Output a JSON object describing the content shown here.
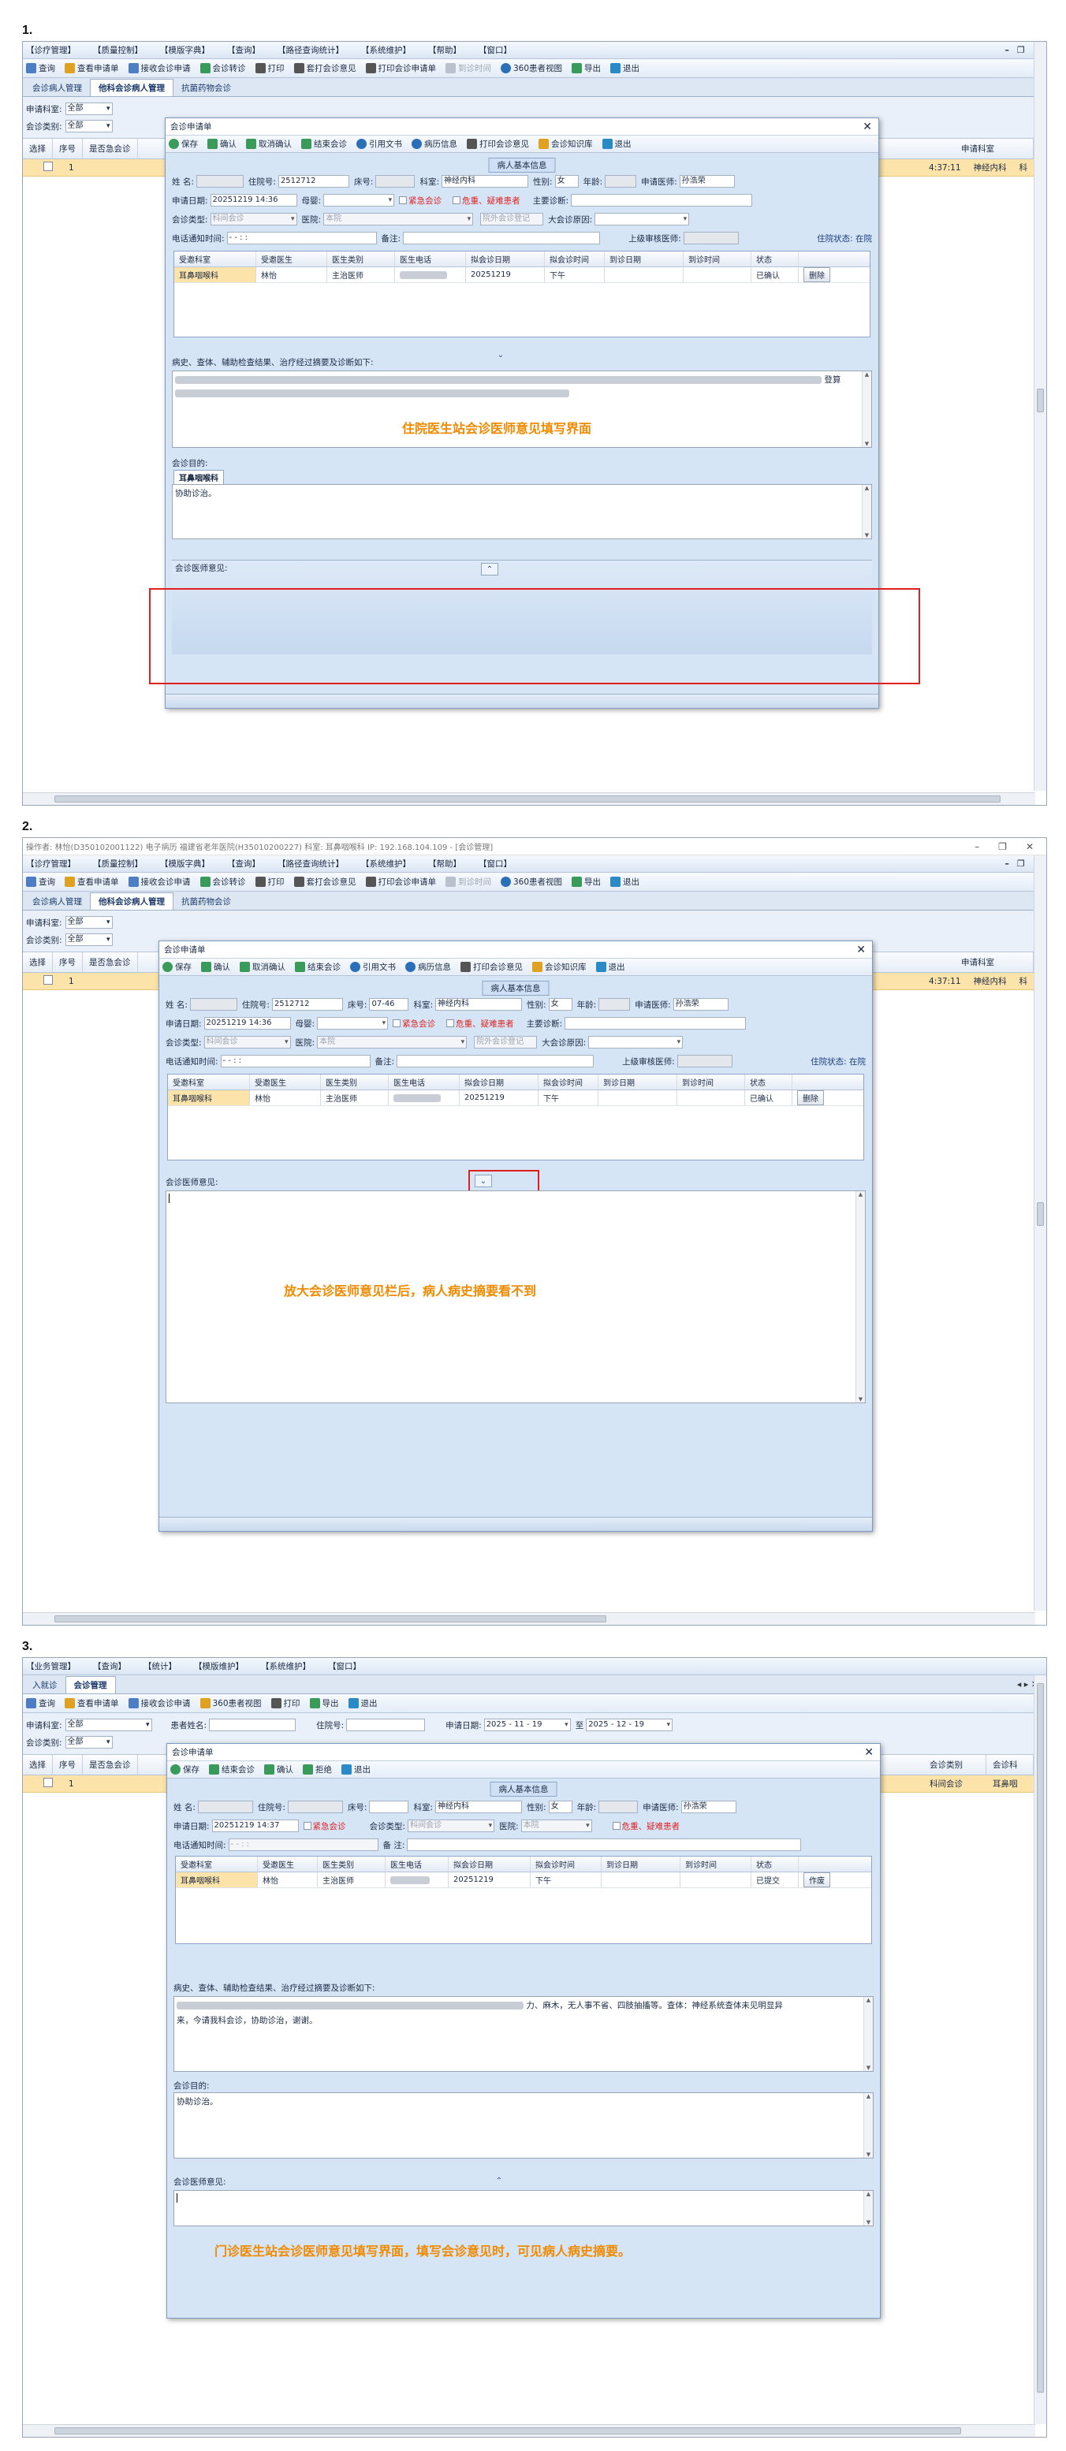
{
  "s1": {
    "num": "1.",
    "menu": [
      "【诊疗管理】",
      "【质量控制】",
      "【模版字典】",
      "【查询】",
      "【路径查询统计】",
      "【系统维护】",
      "【帮助】",
      "【窗口】"
    ],
    "tools": [
      "查询",
      "查看申请单",
      "接收会诊申请",
      "会诊转诊",
      "打印",
      "套打会诊意见",
      "打印会诊申请单",
      "到诊时间",
      "360患者视图",
      "导出",
      "退出"
    ],
    "tabs": [
      "会诊病人管理",
      "他科会诊病人管理",
      "抗菌药物会诊"
    ],
    "filter1_label": "申请科室:",
    "filter1_val": "全部",
    "filter2_label": "会诊类别:",
    "filter2_val": "全部",
    "grid_cols": [
      "选择",
      "序号",
      "是否急会诊"
    ],
    "grid_right_cols": [
      "申请科室"
    ],
    "row_num": "1",
    "row_time": "4:37:11",
    "row_dept": "神经内科",
    "row_extra": "科",
    "dlg_title": "会诊申请单",
    "dlg_tools": [
      "保存",
      "确认",
      "取消确认",
      "结束会诊",
      "引用文书",
      "病历信息",
      "打印会诊意见",
      "会诊知识库",
      "退出"
    ],
    "group_title": "病人基本信息",
    "name_lbl": "姓  名:",
    "hosp_lbl": "住院号:",
    "hosp_val": "2512712",
    "bed_lbl": "床号:",
    "dept_lbl": "科室:",
    "dept_val": "神经内科",
    "sex_lbl": "性别:",
    "sex_val": "女",
    "age_lbl": "年龄:",
    "doc_lbl": "申请医师:",
    "doc_val": "孙浩荣",
    "date_lbl": "申请日期:",
    "date_val": "20251219 14:36",
    "mother_lbl": "母婴:",
    "urgent": "紧急会诊",
    "danger": "危重、疑难患者",
    "diag_lbl": "主要诊断:",
    "type_lbl": "会诊类型:",
    "type_val": "科间会诊",
    "hospital_lbl": "医院:",
    "hospital_val": "本院",
    "outside": "院外会诊登记",
    "reason_lbl": "大会诊原因:",
    "phone_lbl": "电话通知时间:",
    "phone_val": "-   -       :   :",
    "remark_lbl": "备注:",
    "superior_lbl": "上级审核医师:",
    "inpat_status": "住院状态: 在院",
    "tbl_cols": [
      "受邀科室",
      "受邀医生",
      "医生类别",
      "医生电话",
      "拟会诊日期",
      "拟会诊时间",
      "到诊日期",
      "到诊时间",
      "状态"
    ],
    "tbl_row": [
      "耳鼻咽喉科",
      "林怡",
      "主治医师",
      "",
      "20251219",
      "下午",
      "",
      "",
      "已确认"
    ],
    "tbl_btn": "删除",
    "history_lbl": "病史、查体、辅助检查结果、治疗经过摘要及诊断如下:",
    "history_tail": "登算",
    "purpose_lbl": "会诊目的:",
    "purpose_tab": "耳鼻咽喉科",
    "purpose_val": "协助诊治。",
    "opinion_lbl": "会诊医师意见:",
    "annotation": "住院医生站会诊医师意见填写界面"
  },
  "s2": {
    "num": "2.",
    "os_title": "操作者: 林怡(D350102001122) 电子病历  福建省老年医院(H35010200227) 科室: 耳鼻咽喉科  IP: 192.168.104.109 - [会诊管理]",
    "annotation": "放大会诊医师意见栏后，病人病史摘要看不到"
  },
  "s3": {
    "num": "3.",
    "menu": [
      "【业务管理】",
      "【查询】",
      "【统计】",
      "【模版维护】",
      "【系统维护】",
      "【窗口】"
    ],
    "tabs": [
      "入就诊",
      "会诊管理"
    ],
    "tools": [
      "查询",
      "查看申请单",
      "接收会诊申请",
      "360患者视图",
      "打印",
      "导出",
      "退出"
    ],
    "patient_lbl": "患者姓名:",
    "hosp_lbl": "住院号:",
    "date_lbl": "申请日期:",
    "date_from": "2025 - 11 - 19",
    "to": "至",
    "date_to": "2025 - 12 - 19",
    "right_cols": [
      "会诊类别",
      "会诊科"
    ],
    "row_right": [
      "科间会诊",
      "耳鼻咽"
    ],
    "dlg_tools": [
      "保存",
      "结束会诊",
      "确认",
      "拒绝",
      "退出"
    ],
    "bed_val": "07-46",
    "date_val": "20251219 14:37",
    "remark_lbl": "备  注:",
    "status_val": "已提交",
    "tbl_btn": "作废",
    "history_text": "力、麻木，无人事不省、四肢抽搐等。查体：神经系统查体未见明显异",
    "history_line2": "来，今请我科会诊，协助诊治，谢谢。",
    "annotation": "门诊医生站会诊医师意见填写界面，填写会诊意见时，可见病人病史摘要。"
  }
}
